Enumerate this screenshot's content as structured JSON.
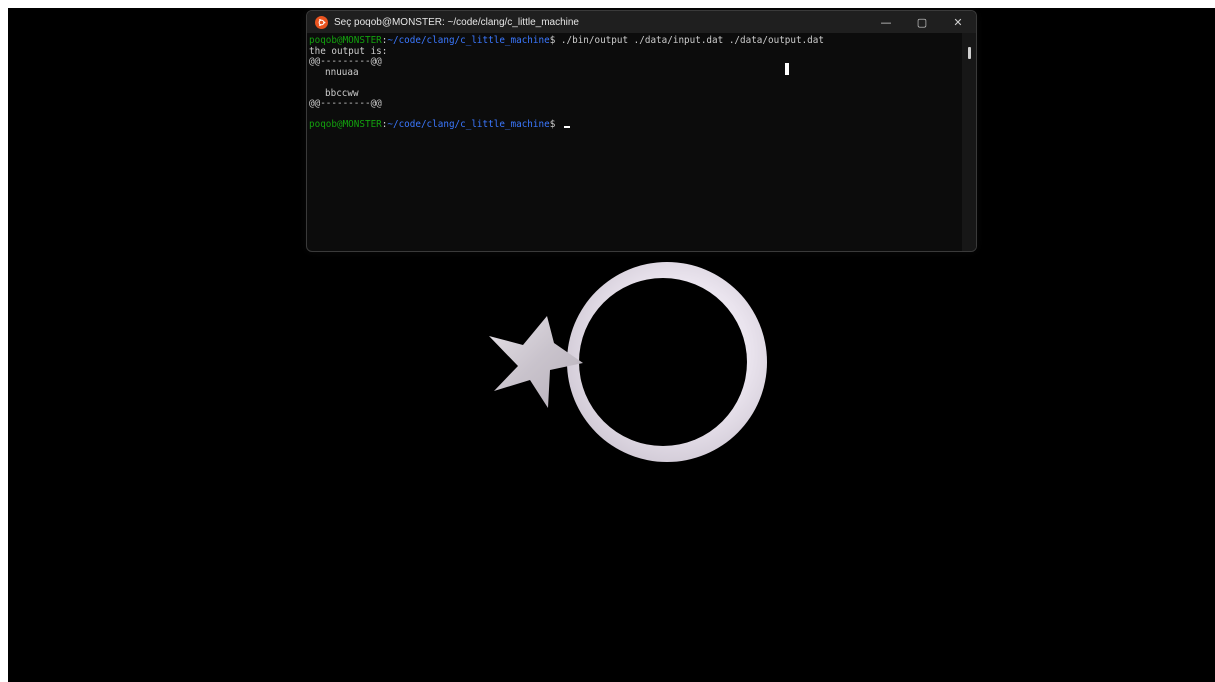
{
  "window": {
    "title": "Seç poqob@MONSTER: ~/code/clang/c_little_machine",
    "app_icon": "ubuntu-icon",
    "controls": {
      "minimize": "—",
      "maximize": "▢",
      "close": "✕"
    }
  },
  "terminal": {
    "prompt_user": "poqob@MONSTER",
    "prompt_sep": ":",
    "prompt_path": "~/code/clang/c_little_machine",
    "prompt_symbol": "$ ",
    "command": "./bin/output ./data/input.dat ./data/output.dat",
    "output_lines": {
      "header": "the output is:",
      "border_top": "@@---------@@",
      "row1": "nnuuaa",
      "row2": "bbccww",
      "border_bottom": "@@---------@@"
    }
  },
  "colors": {
    "desktop_bg": "#000000",
    "terminal_bg": "#0c0c0c",
    "titlebar_bg": "#1f1f1f",
    "prompt_user": "#13a10e",
    "prompt_path": "#3b78ff",
    "text": "#cccccc",
    "emblem": "#e8e2ea"
  },
  "emblem": {
    "shapes": [
      "crescent",
      "star"
    ]
  }
}
